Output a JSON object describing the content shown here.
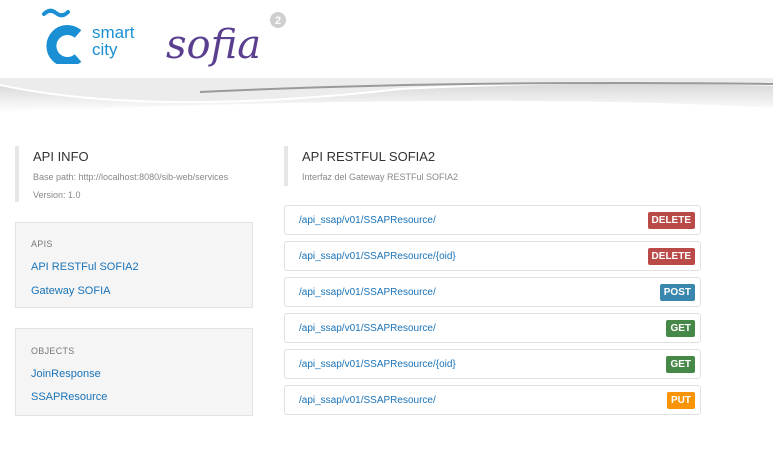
{
  "brand": {
    "smart_label": "smart",
    "city_label": "city",
    "sofia_label": "sofia",
    "sofia_version": "2"
  },
  "api_info": {
    "title": "API INFO",
    "base_path": "Base path: http://localhost:8080/sib-web/services",
    "version": "Version: 1.0"
  },
  "apis_panel": {
    "title": "APIS",
    "links": [
      "API RESTFul SOFIA2",
      "Gateway SOFIA"
    ]
  },
  "objects_panel": {
    "title": "OBJECTS",
    "links": [
      "JoinResponse",
      "SSAPResource"
    ]
  },
  "api_restful": {
    "title": "API RESTFUL SOFIA2",
    "subtitle": "Interfaz del Gateway RESTFul SOFIA2"
  },
  "endpoints": [
    {
      "path": "/api_ssap/v01/SSAPResource/",
      "method": "DELETE"
    },
    {
      "path": "/api_ssap/v01/SSAPResource/{oid}",
      "method": "DELETE"
    },
    {
      "path": "/api_ssap/v01/SSAPResource/",
      "method": "POST"
    },
    {
      "path": "/api_ssap/v01/SSAPResource/",
      "method": "GET"
    },
    {
      "path": "/api_ssap/v01/SSAPResource/{oid}",
      "method": "GET"
    },
    {
      "path": "/api_ssap/v01/SSAPResource/",
      "method": "PUT"
    }
  ],
  "colors": {
    "delete": "#b94a48",
    "post": "#3a87ad",
    "get": "#468847",
    "put": "#f89406",
    "link": "#1a73b8",
    "brand_blue": "#1a8fd3"
  }
}
